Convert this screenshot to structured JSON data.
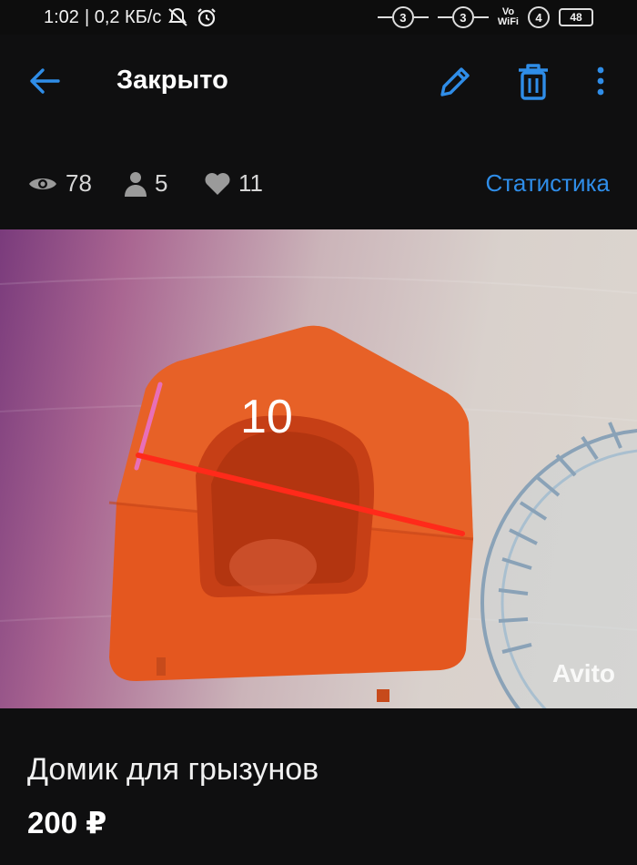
{
  "status_bar": {
    "time": "1:02",
    "speed": "| 0,2 КБ/с",
    "sim1": "3",
    "sim2": "3",
    "wifi_vo": "Vo",
    "wifi_label": "WiFi",
    "signal": "4",
    "battery": "48"
  },
  "appbar": {
    "title": "Закрыто",
    "icons": [
      "arrow-left-icon",
      "pencil-icon",
      "trash-icon",
      "more-vertical-icon"
    ]
  },
  "stats": {
    "views": "78",
    "contacts": "5",
    "favorites": "11",
    "link_label": "Статистика"
  },
  "photo": {
    "measure_label": "10",
    "watermark": "Avito"
  },
  "listing": {
    "title": "Домик для грызунов",
    "price": "200 ₽"
  },
  "colors": {
    "background": "#0f0f10",
    "accent": "#2f8de8",
    "product": "#e4571f"
  }
}
